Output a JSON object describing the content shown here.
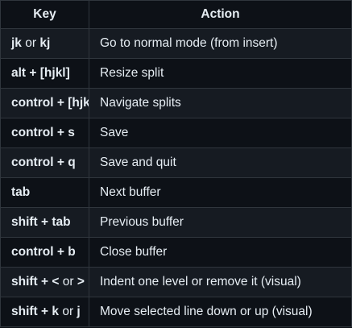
{
  "headers": {
    "key": "Key",
    "action": "Action"
  },
  "rows": [
    {
      "key": [
        {
          "t": "jk",
          "b": true
        },
        {
          "t": " or ",
          "b": false
        },
        {
          "t": "kj",
          "b": true
        }
      ],
      "action": "Go to normal mode (from insert)"
    },
    {
      "key": [
        {
          "t": "alt + [hjkl]",
          "b": true
        }
      ],
      "action": "Resize split"
    },
    {
      "key": [
        {
          "t": "control + [hjkl]",
          "b": true
        }
      ],
      "action": "Navigate splits"
    },
    {
      "key": [
        {
          "t": "control + s",
          "b": true
        }
      ],
      "action": "Save"
    },
    {
      "key": [
        {
          "t": "control + q",
          "b": true
        }
      ],
      "action": "Save and quit"
    },
    {
      "key": [
        {
          "t": "tab",
          "b": true
        }
      ],
      "action": "Next buffer"
    },
    {
      "key": [
        {
          "t": "shift + tab",
          "b": true
        }
      ],
      "action": "Previous buffer"
    },
    {
      "key": [
        {
          "t": "control + b",
          "b": true
        }
      ],
      "action": "Close buffer"
    },
    {
      "key": [
        {
          "t": "shift + <",
          "b": true
        },
        {
          "t": " or ",
          "b": false
        },
        {
          "t": ">",
          "b": true
        }
      ],
      "action": "Indent one level or remove it (visual)"
    },
    {
      "key": [
        {
          "t": "shift + k",
          "b": true
        },
        {
          "t": " or ",
          "b": false
        },
        {
          "t": "j",
          "b": true
        }
      ],
      "action": "Move selected line down or up (visual)"
    }
  ],
  "colors": {
    "background": "#0d1117",
    "row_alt": "#161b22",
    "border": "#30363d",
    "text": "#e6edf3"
  }
}
